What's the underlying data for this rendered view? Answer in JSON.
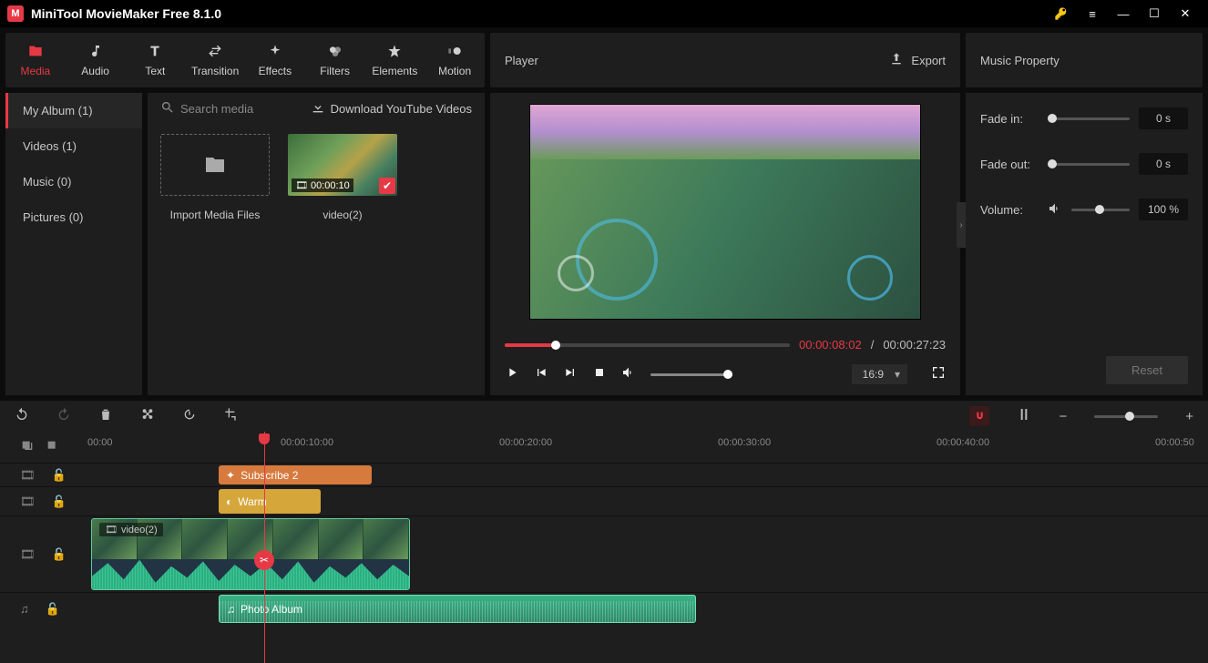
{
  "app": {
    "title": "MiniTool MovieMaker Free 8.1.0"
  },
  "tabs": [
    {
      "label": "Media",
      "glyph": "folder"
    },
    {
      "label": "Audio",
      "glyph": "music"
    },
    {
      "label": "Text",
      "glyph": "text"
    },
    {
      "label": "Transition",
      "glyph": "swap"
    },
    {
      "label": "Effects",
      "glyph": "sparkle"
    },
    {
      "label": "Filters",
      "glyph": "filter"
    },
    {
      "label": "Elements",
      "glyph": "star"
    },
    {
      "label": "Motion",
      "glyph": "motion"
    }
  ],
  "player_title": "Player",
  "export_label": "Export",
  "prop_title": "Music Property",
  "sidebar": [
    {
      "label": "My Album (1)"
    },
    {
      "label": "Videos (1)"
    },
    {
      "label": "Music (0)"
    },
    {
      "label": "Pictures (0)"
    }
  ],
  "media": {
    "search_placeholder": "Search media",
    "download_label": "Download YouTube Videos",
    "import_label": "Import Media Files",
    "clip": {
      "duration": "00:00:10",
      "name": "video(2)"
    }
  },
  "player": {
    "current": "00:00:08:02",
    "total": "00:00:27:23",
    "aspect": "16:9"
  },
  "props": {
    "fade_in": {
      "label": "Fade in:",
      "value": "0 s"
    },
    "fade_out": {
      "label": "Fade out:",
      "value": "0 s"
    },
    "volume": {
      "label": "Volume:",
      "value": "100 %"
    },
    "reset": "Reset"
  },
  "timeline": {
    "marks": [
      "00:00",
      "00:00:10:00",
      "00:00:20:00",
      "00:00:30:00",
      "00:00:40:00",
      "00:00:50"
    ],
    "clip_subscribe": "Subscribe 2",
    "clip_warm": "Warm",
    "clip_video": "video(2)",
    "clip_audio": "Photo Album"
  }
}
